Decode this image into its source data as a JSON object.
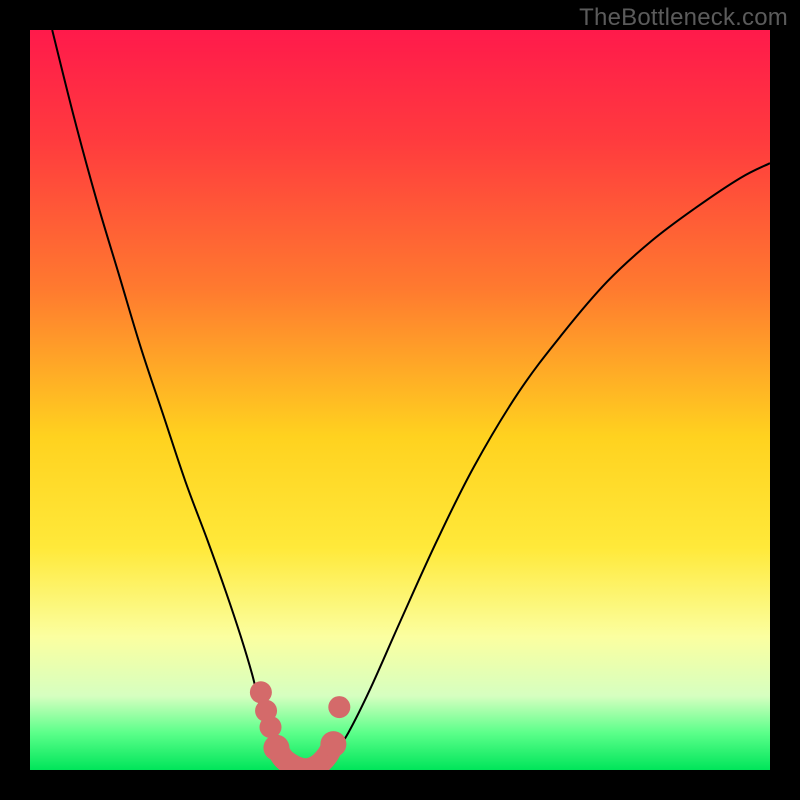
{
  "watermark": "TheBottleneck.com",
  "chart_data": {
    "type": "line",
    "title": "",
    "xlabel": "",
    "ylabel": "",
    "xlim": [
      0,
      100
    ],
    "ylim": [
      0,
      100
    ],
    "gradient_stops": [
      {
        "offset": 0.0,
        "color": "#ff1a4b"
      },
      {
        "offset": 0.15,
        "color": "#ff3b3e"
      },
      {
        "offset": 0.35,
        "color": "#ff7a2f"
      },
      {
        "offset": 0.55,
        "color": "#ffd21f"
      },
      {
        "offset": 0.7,
        "color": "#ffe93a"
      },
      {
        "offset": 0.82,
        "color": "#fbffa0"
      },
      {
        "offset": 0.9,
        "color": "#d6ffc0"
      },
      {
        "offset": 0.95,
        "color": "#5bff8a"
      },
      {
        "offset": 1.0,
        "color": "#00e55a"
      }
    ],
    "series": [
      {
        "name": "left-branch",
        "stroke": "#000000",
        "width": 2.0,
        "points": [
          {
            "x": 3.0,
            "y": 100.0
          },
          {
            "x": 6.0,
            "y": 88.0
          },
          {
            "x": 9.0,
            "y": 77.0
          },
          {
            "x": 12.0,
            "y": 67.0
          },
          {
            "x": 15.0,
            "y": 57.0
          },
          {
            "x": 18.0,
            "y": 48.0
          },
          {
            "x": 21.0,
            "y": 39.0
          },
          {
            "x": 24.0,
            "y": 31.0
          },
          {
            "x": 26.5,
            "y": 24.0
          },
          {
            "x": 28.5,
            "y": 18.0
          },
          {
            "x": 30.0,
            "y": 13.0
          },
          {
            "x": 31.0,
            "y": 9.0
          },
          {
            "x": 32.0,
            "y": 5.5
          },
          {
            "x": 33.0,
            "y": 3.0
          },
          {
            "x": 34.0,
            "y": 1.4
          },
          {
            "x": 35.0,
            "y": 0.6
          },
          {
            "x": 36.0,
            "y": 0.2
          },
          {
            "x": 37.0,
            "y": 0.0
          }
        ]
      },
      {
        "name": "right-branch",
        "stroke": "#000000",
        "width": 2.0,
        "points": [
          {
            "x": 37.0,
            "y": 0.0
          },
          {
            "x": 38.0,
            "y": 0.1
          },
          {
            "x": 39.0,
            "y": 0.4
          },
          {
            "x": 40.0,
            "y": 1.0
          },
          {
            "x": 41.0,
            "y": 2.0
          },
          {
            "x": 43.0,
            "y": 5.0
          },
          {
            "x": 46.0,
            "y": 11.0
          },
          {
            "x": 50.0,
            "y": 20.0
          },
          {
            "x": 55.0,
            "y": 31.0
          },
          {
            "x": 60.0,
            "y": 41.0
          },
          {
            "x": 66.0,
            "y": 51.0
          },
          {
            "x": 72.0,
            "y": 59.0
          },
          {
            "x": 78.0,
            "y": 66.0
          },
          {
            "x": 84.0,
            "y": 71.5
          },
          {
            "x": 90.0,
            "y": 76.0
          },
          {
            "x": 96.0,
            "y": 80.0
          },
          {
            "x": 100.0,
            "y": 82.0
          }
        ]
      }
    ],
    "markers": {
      "stroke": "#d46a6a",
      "fill": "#d46a6a",
      "radius": 11,
      "cap_radius": 13,
      "points_left_descent": [
        {
          "x": 31.2,
          "y": 10.5
        },
        {
          "x": 31.9,
          "y": 8.0
        },
        {
          "x": 32.5,
          "y": 5.8
        }
      ],
      "points_right_ascent": [
        {
          "x": 41.8,
          "y": 8.5
        }
      ],
      "valley_path": [
        {
          "x": 33.3,
          "y": 3.0
        },
        {
          "x": 34.2,
          "y": 1.6
        },
        {
          "x": 35.2,
          "y": 0.8
        },
        {
          "x": 36.2,
          "y": 0.3
        },
        {
          "x": 37.2,
          "y": 0.1
        },
        {
          "x": 38.2,
          "y": 0.3
        },
        {
          "x": 39.2,
          "y": 0.9
        },
        {
          "x": 40.2,
          "y": 2.0
        },
        {
          "x": 41.0,
          "y": 3.5
        }
      ]
    }
  }
}
